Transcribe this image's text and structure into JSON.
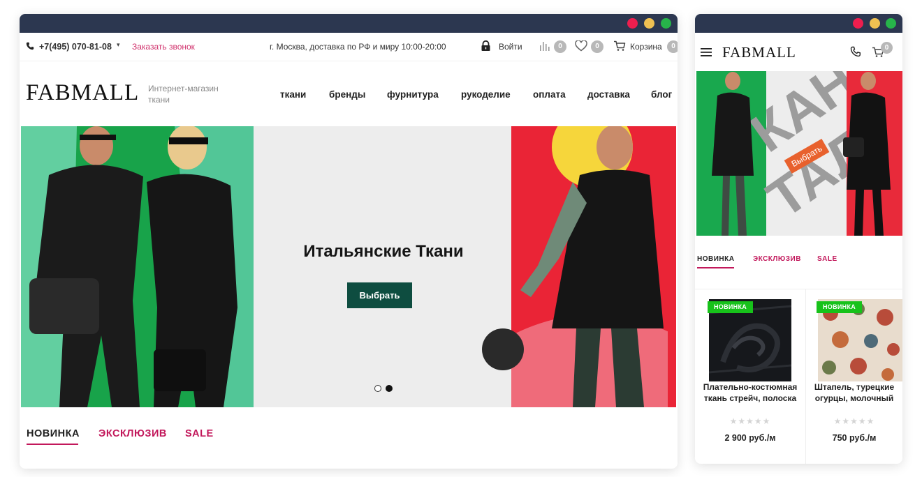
{
  "desktop": {
    "topbar": {
      "phone": "+7(495) 070-81-08",
      "callback": "Заказать звонок",
      "delivery": "г. Москва, доставка по РФ и миру  10:00-20:00",
      "login": "Войти",
      "compare_count": "0",
      "favorites_count": "0",
      "cart_label": "Корзина",
      "cart_count": "0"
    },
    "header": {
      "logo": "FABMALL",
      "tagline_line1": "Интернет-магазин",
      "tagline_line2": "ткани",
      "nav": [
        "ткани",
        "бренды",
        "фурнитура",
        "рукоделие",
        "оплата",
        "доставка",
        "блог"
      ]
    },
    "hero": {
      "title": "Итальянские Ткани",
      "button": "Выбрать"
    },
    "tabs": [
      "НОВИНКА",
      "ЭКСКЛЮЗИВ",
      "SALE"
    ]
  },
  "mobile": {
    "logo": "FABMALL",
    "cart_count": "0",
    "hero_badge": "Выбрать",
    "tabs": [
      "НОВИНКА",
      "ЭКСКЛЮЗИВ",
      "SALE"
    ],
    "products": [
      {
        "badge": "НОВИНКА",
        "name": "Плательно-костюмная ткань стрейч, полоска",
        "stars": "★★★★★",
        "price": "2 900 руб./м"
      },
      {
        "badge": "НОВИНКА",
        "name": "Штапель, турецкие огурцы, молочный",
        "stars": "★★★★★",
        "price": "750 руб./м"
      }
    ]
  },
  "colors": {
    "titlebar": "#2c3750",
    "accent_pink": "#c2185b",
    "hero_button": "#0e4d40",
    "badge_green": "#17c21a",
    "hero_green": "#18a34a",
    "hero_red": "#ea2436"
  }
}
